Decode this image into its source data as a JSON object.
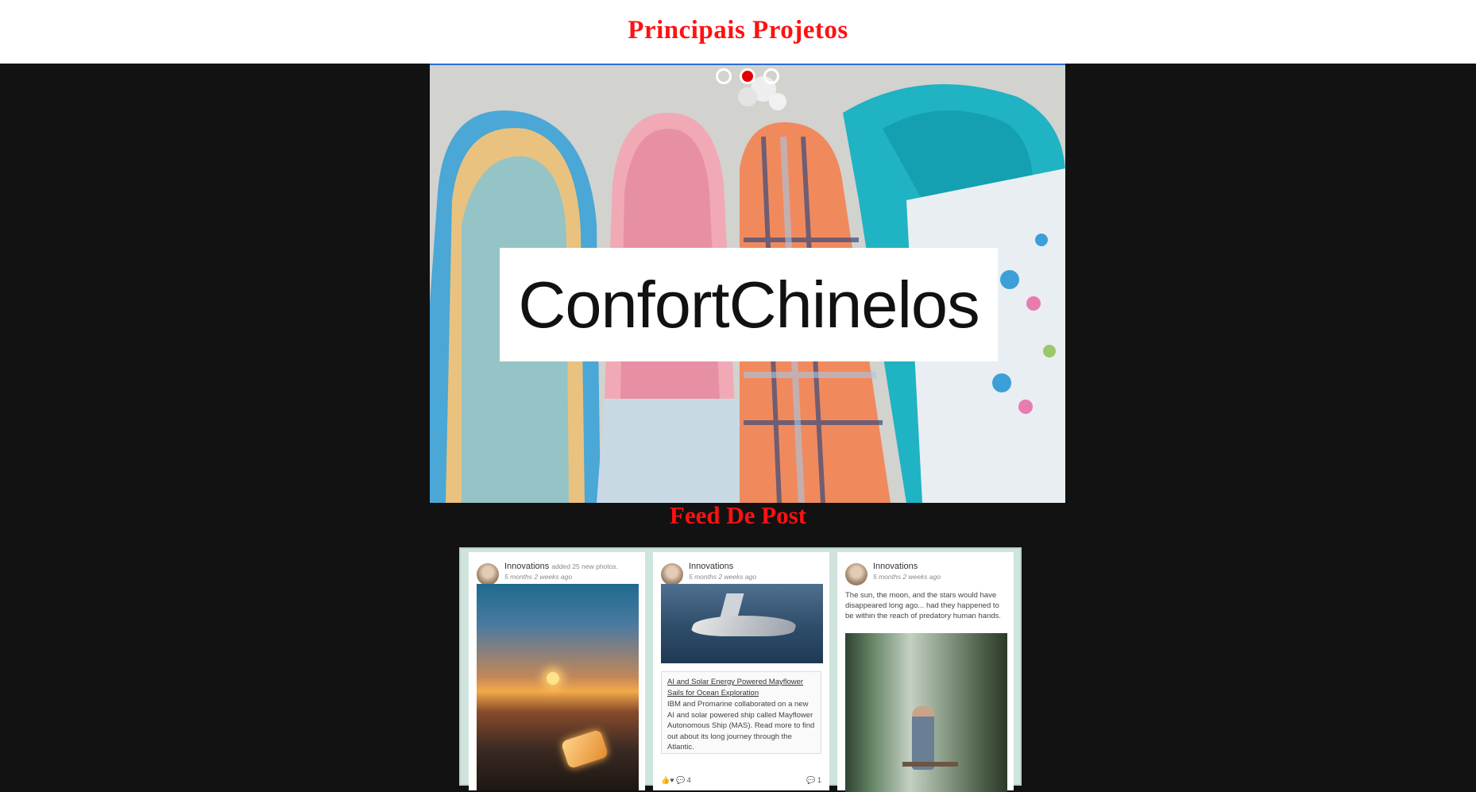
{
  "header": {
    "title": "Principais Projetos"
  },
  "carousel": {
    "indicators": 3,
    "active_index": 1,
    "brand_text": "ConfortChinelos",
    "colors": {
      "active_dot": "#e10000",
      "border": "#2c6fd6"
    }
  },
  "feed": {
    "title": "Feed De Post",
    "posts": [
      {
        "author": "Innovations",
        "action": "added 25 new photos.",
        "time": "5 months 2 weeks ago"
      },
      {
        "author": "Innovations",
        "time": "5 months 2 weeks ago",
        "link_title": "AI and Solar Energy Powered Mayflower Sails for Ocean Exploration",
        "link_body": "IBM and Promarine collaborated on a new AI and solar powered ship called Mayflower Autonomous Ship (MAS). Read more to find out about its long journey through the Atlantic.",
        "reactions": "4",
        "comments": "1"
      },
      {
        "author": "Innovations",
        "time": "5 months 2 weeks ago",
        "text": "The sun, the moon, and the stars would have disappeared long ago... had they happened to be within the reach of predatory human hands."
      }
    ]
  },
  "colors": {
    "title_red": "#ff1111",
    "page_bg": "#121212"
  }
}
